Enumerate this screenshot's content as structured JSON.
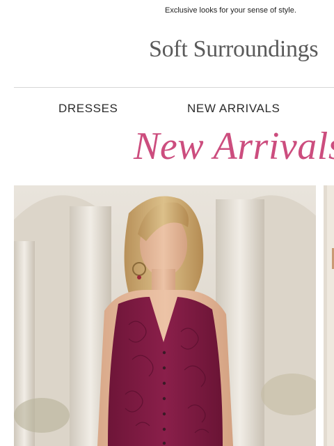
{
  "preheader": {
    "text": "Exclusive looks for your sense of style."
  },
  "brand": {
    "logo_text": "Soft Surroundings"
  },
  "nav": {
    "items": [
      {
        "label": "DRESSES"
      },
      {
        "label": "NEW ARRIVALS"
      }
    ]
  },
  "hero": {
    "headline": "New Arrivals"
  },
  "colors": {
    "headline": "#cc4d7e",
    "logo": "#5a5a5a",
    "divider": "#d6d6d6",
    "dress": "#8a1f4a"
  }
}
